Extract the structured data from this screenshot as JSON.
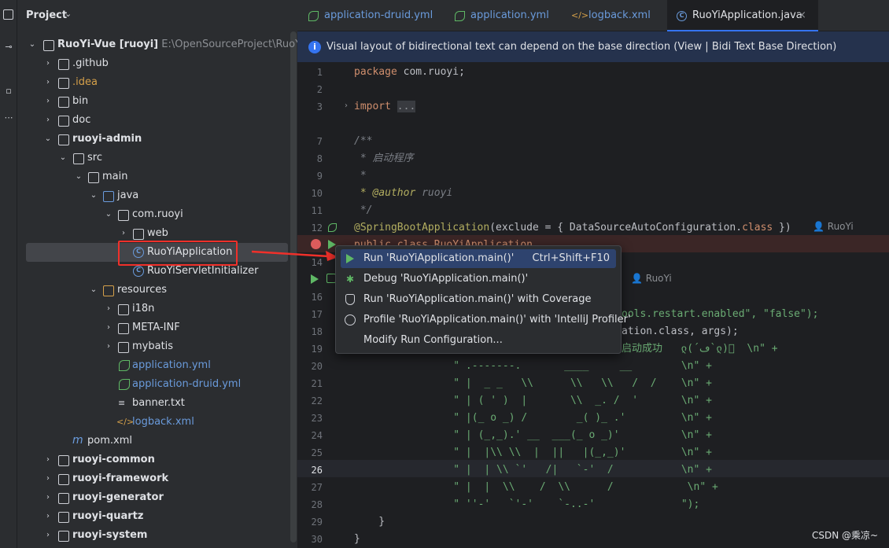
{
  "project_panel": {
    "title": "Project",
    "tree": [
      {
        "label": "RuoYi-Vue [ruoyi]",
        "path": "E:\\OpenSourceProject\\RuoYi\\Ruo",
        "name": "tree-root-ruoyi-vue"
      },
      {
        "label": ".github",
        "name": "tree-item-github"
      },
      {
        "label": ".idea",
        "name": "tree-item-idea"
      },
      {
        "label": "bin",
        "name": "tree-item-bin"
      },
      {
        "label": "doc",
        "name": "tree-item-doc"
      },
      {
        "label": "ruoyi-admin",
        "name": "tree-item-ruoyi-admin"
      },
      {
        "label": "src",
        "name": "tree-item-src"
      },
      {
        "label": "main",
        "name": "tree-item-main"
      },
      {
        "label": "java",
        "name": "tree-item-java"
      },
      {
        "label": "com.ruoyi",
        "name": "tree-item-com-ruoyi"
      },
      {
        "label": "web",
        "name": "tree-item-web"
      },
      {
        "label": "RuoYiApplication",
        "name": "tree-item-ruoyiapplication"
      },
      {
        "label": "RuoYiServletInitializer",
        "name": "tree-item-ruoyiservletinitializer"
      },
      {
        "label": "resources",
        "name": "tree-item-resources"
      },
      {
        "label": "i18n",
        "name": "tree-item-i18n"
      },
      {
        "label": "META-INF",
        "name": "tree-item-meta-inf"
      },
      {
        "label": "mybatis",
        "name": "tree-item-mybatis"
      },
      {
        "label": "application.yml",
        "name": "tree-item-application-yml"
      },
      {
        "label": "application-druid.yml",
        "name": "tree-item-application-druid-yml"
      },
      {
        "label": "banner.txt",
        "name": "tree-item-banner-txt"
      },
      {
        "label": "logback.xml",
        "name": "tree-item-logback-xml"
      },
      {
        "label": "pom.xml",
        "name": "tree-item-pom-xml"
      },
      {
        "label": "ruoyi-common",
        "name": "tree-item-ruoyi-common"
      },
      {
        "label": "ruoyi-framework",
        "name": "tree-item-ruoyi-framework"
      },
      {
        "label": "ruoyi-generator",
        "name": "tree-item-ruoyi-generator"
      },
      {
        "label": "ruoyi-quartz",
        "name": "tree-item-ruoyi-quartz"
      },
      {
        "label": "ruoyi-system",
        "name": "tree-item-ruoyi-system"
      }
    ]
  },
  "tabs": [
    {
      "label": "application-druid.yml"
    },
    {
      "label": "application.yml"
    },
    {
      "label": "logback.xml"
    },
    {
      "label": "RuoYiApplication.java",
      "close": "×"
    }
  ],
  "banner": {
    "info_glyph": "i",
    "text": "Visual layout of bidirectional text can depend on the base direction (View | Bidi Text Base Direction)"
  },
  "editor": {
    "line_numbers": [
      "1",
      "2",
      "3",
      "7",
      "8",
      "9",
      "10",
      "11",
      "12",
      "13",
      "14",
      "15",
      "16",
      "17",
      "18",
      "19",
      "20",
      "21",
      "22",
      "23",
      "24",
      "25",
      "26",
      "27",
      "28",
      "29",
      "30"
    ],
    "lines": {
      "l1_kw": "package",
      "l1_rest": " com.ruoyi;",
      "l3_kw": "import",
      "l3_fold": "...",
      "l7": "/**",
      "l8": " * 启动程序",
      "l9": " *",
      "l10_tag": " * @author",
      "l10_rest": " ruoyi",
      "l11": " */",
      "l12_an": "@SpringBootApplication",
      "l12_a": "(exclude = { DataSourceAutoConfiguration.",
      "l12_kw": "class",
      "l12_b": " })",
      "l13": "public class RuoYiApplication",
      "l17": "ools.restart.enabled\", \"false\");",
      "l18": "ation.class, args);",
      "l19_a": "启动成功   ლ(´ڡ`ლ)゙  ",
      "l19_b": "\\n\" +",
      "l20": "          \" .-------.       ____     __        \\n\" +",
      "l21": "          \" |  _ _   \\\\      \\\\   \\\\   /  /    \\n\" +",
      "l22": "          \" | ( ' )  |       \\\\  _. /  '       \\n\" +",
      "l23": "          \" |(_ o _) /        _( )_ .'         \\n\" +",
      "l24": "          \" | (_,_).' __  ___(_ o _)'          \\n\" +",
      "l25": "          \" |  |\\\\ \\\\  |  ||   |(_,_)'         \\n\" +",
      "l26": "          \" |  | \\\\ `'   /|   `-'  /           \\n\" +",
      "l27": "          \" |  |  \\\\    /  \\\\      /            \\n\" +",
      "l28": "          \" ''-'   `'-'    `-..-'              \");",
      "l29": "    }",
      "l30": "}"
    },
    "author_hint_1": "RuoYi",
    "author_hint_2": "RuoYi"
  },
  "popup": {
    "items": [
      {
        "label": "Run 'RuoYiApplication.main()'",
        "shortcut": "Ctrl+Shift+F10",
        "icon": "run-icon"
      },
      {
        "label": "Debug 'RuoYiApplication.main()'",
        "icon": "debug-icon"
      },
      {
        "label": "Run 'RuoYiApplication.main()' with Coverage",
        "icon": "coverage-icon"
      },
      {
        "label": "Profile 'RuoYiApplication.main()' with 'IntelliJ Profiler'",
        "icon": "profiler-icon"
      },
      {
        "label": "Modify Run Configuration...",
        "icon": ""
      }
    ]
  },
  "watermark": "CSDN @乘凉~",
  "colors": {
    "accent": "#3574f0",
    "selection": "#2e436e",
    "annotation_red": "#f0302a"
  }
}
